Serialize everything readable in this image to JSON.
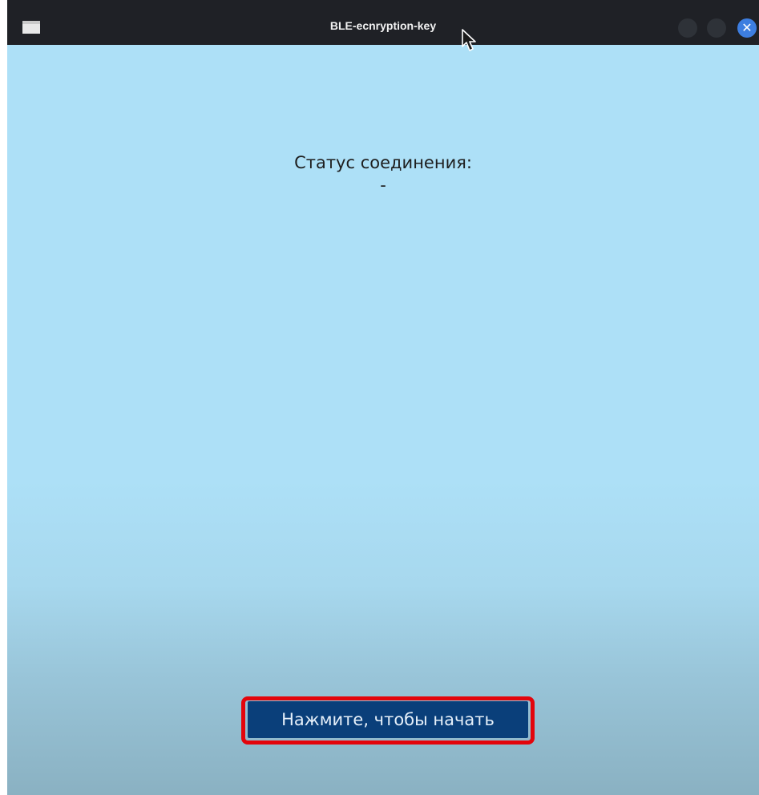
{
  "window": {
    "title": "BLE-ecnryption-key",
    "icons": {
      "app": "window-icon",
      "minimize": "minimize-icon",
      "maximize": "maximize-icon",
      "close": "close-icon",
      "close_glyph": "✕"
    }
  },
  "status": {
    "label": "Статус соединения:",
    "value": "-"
  },
  "start_button": {
    "label": "Нажмите, чтобы начать"
  },
  "colors": {
    "titlebar": "#1f2126",
    "background_top": "#ade0f7",
    "background_bottom": "#8ab1c2",
    "button": "#0a3f7a",
    "highlight": "#e3050c",
    "close_button": "#3d7ee0"
  }
}
